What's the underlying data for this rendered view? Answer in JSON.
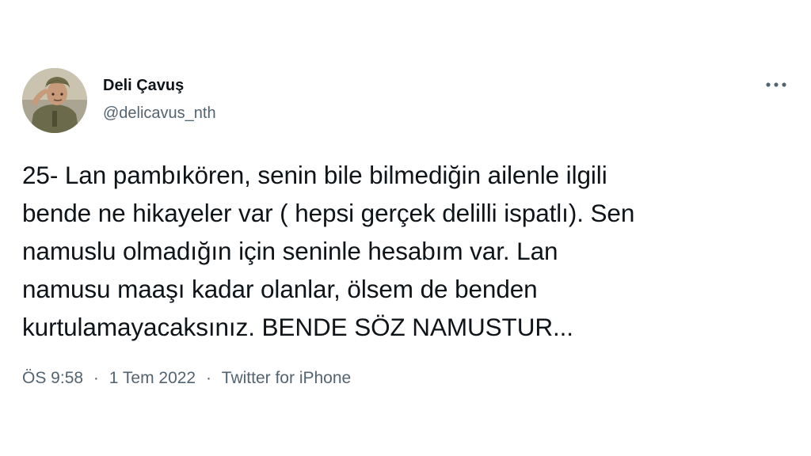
{
  "user": {
    "display_name": "Deli Çavuş",
    "handle": "@delicavus_nth"
  },
  "tweet": {
    "lines": [
      "25- Lan pambıkören, senin bile bilmediğin ailenle ilgili",
      "bende ne hikayeler var ( hepsi gerçek delilli ispatlı). Sen",
      "namuslu olmadığın için seninle hesabım var. Lan",
      "namusu maaşı kadar olanlar, ölsem de benden",
      "kurtulamayacaksınız. BENDE SÖZ NAMUSTUR..."
    ]
  },
  "meta": {
    "time": "ÖS 9:58",
    "separator": "·",
    "date": "1 Tem 2022",
    "source": "Twitter for iPhone"
  },
  "icons": {
    "more": "more-horizontal-icon"
  },
  "colors": {
    "text": "#0f1419",
    "secondary": "#536471",
    "background": "#ffffff"
  }
}
